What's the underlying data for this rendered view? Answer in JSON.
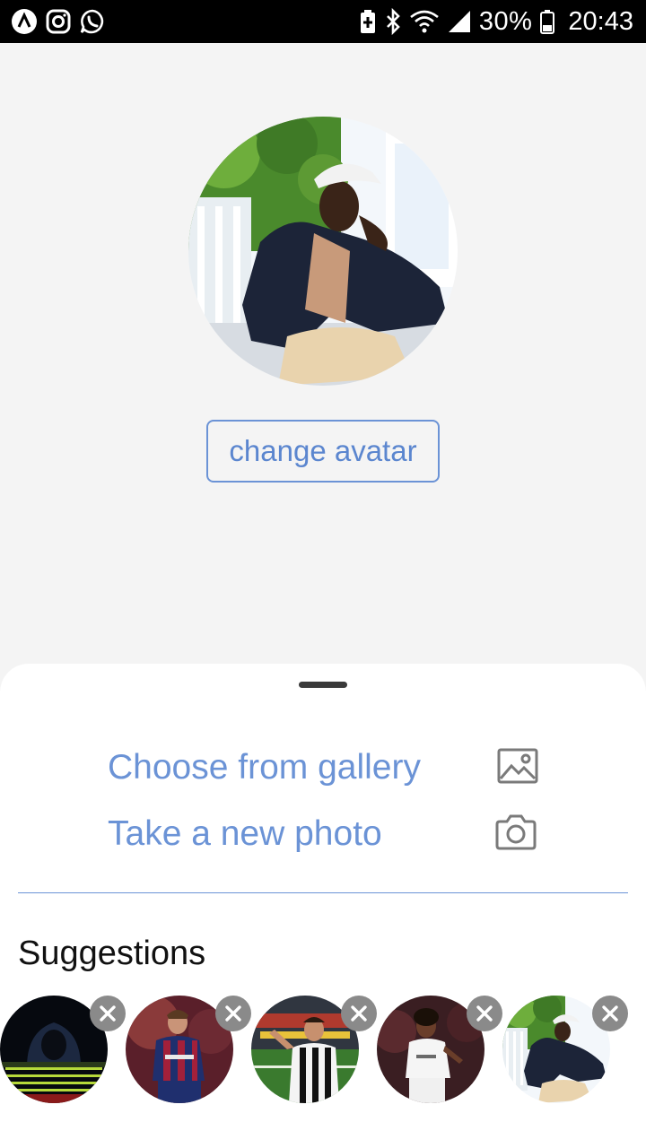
{
  "status_bar": {
    "left_icons": [
      "app-a-icon",
      "instagram-icon",
      "whatsapp-icon"
    ],
    "right_icons": [
      "battery-saver-icon",
      "bluetooth-icon",
      "wifi-icon",
      "signal-icon",
      "battery-icon"
    ],
    "battery": "30%",
    "time": "20:43"
  },
  "profile": {
    "avatar": "profile-photo",
    "change_avatar_label": "change avatar"
  },
  "sheet": {
    "options": [
      {
        "label": "Choose from gallery",
        "icon": "image-icon"
      },
      {
        "label": "Take a new photo",
        "icon": "camera-icon"
      }
    ],
    "suggestions_title": "Suggestions",
    "suggestions": [
      {
        "name": "hooded-figure-photo"
      },
      {
        "name": "barcelona-player-photo"
      },
      {
        "name": "juventus-player-photo"
      },
      {
        "name": "real-madrid-player-photo"
      },
      {
        "name": "profile-photo"
      }
    ]
  },
  "colors": {
    "accent": "#6b93d6",
    "status_bar": "#000000",
    "background": "#f4f4f4",
    "sheet": "#ffffff"
  }
}
